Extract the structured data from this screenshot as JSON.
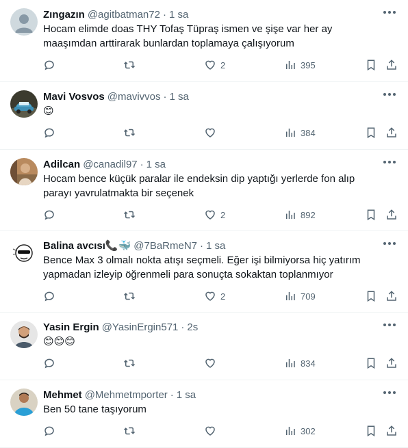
{
  "tweets": [
    {
      "name": "Zıngazın",
      "handle": "@agitbatman72",
      "time": "1 sa",
      "text": "Hocam elimde doas THY Tofaş Tüpraş ismen ve şişe var her ay maaşımdan arttirarak bunlardan toplamaya çalışıyorum",
      "likes": "2",
      "views": "395"
    },
    {
      "name": "Mavi Vosvos",
      "handle": "@mavivvos",
      "time": "1 sa",
      "text": "😊",
      "likes": "",
      "views": "384"
    },
    {
      "name": "Adilcan",
      "handle": "@canadil97",
      "time": "1 sa",
      "text": "Hocam bence küçük paralar ile endeksin dip yaptığı yerlerde fon alıp parayı yavrulatmakta bir seçenek",
      "likes": "2",
      "views": "892"
    },
    {
      "name": "Balina avcısı📞🐳",
      "handle": "@7BaRmeN7",
      "time": "1 sa",
      "text": "Bence Max 3 olmalı nokta atışı seçmeli. Eğer işi bilmiyorsa hiç yatırım yapmadan izleyip öğrenmeli para sonuçta sokaktan toplanmıyor",
      "likes": "2",
      "views": "709"
    },
    {
      "name": "Yasin Ergin",
      "handle": "@YasinErgin571",
      "time": "2s",
      "text": "😊😊😊",
      "likes": "",
      "views": "834"
    },
    {
      "name": "Mehmet",
      "handle": "@Mehmetmporter",
      "time": "1 sa",
      "text": "Ben 50 tane taşıyorum",
      "likes": "",
      "views": "302"
    }
  ],
  "separator": "·",
  "colors": {
    "text": "#0f1419",
    "secondary": "#536471",
    "border": "#eff3f4"
  },
  "icons": [
    "reply-icon",
    "retweet-icon",
    "like-icon",
    "views-icon",
    "bookmark-icon",
    "share-icon",
    "more-icon"
  ]
}
